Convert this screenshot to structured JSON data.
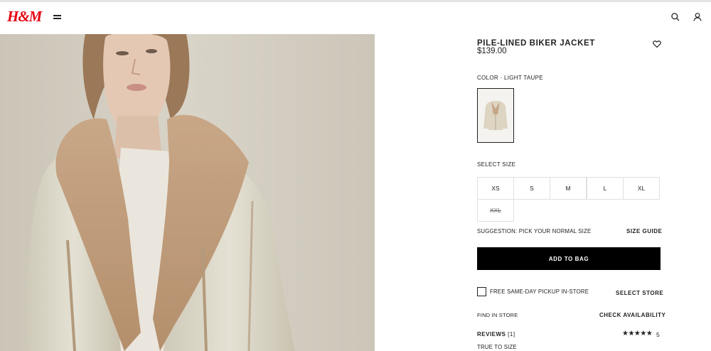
{
  "header": {
    "logo": "H&M"
  },
  "product": {
    "title": "PILE-LINED BIKER JACKET",
    "price": "$139.00",
    "color_label": "COLOR",
    "color_sep": "·",
    "color_value": "LIGHT TAUPE",
    "size_label": "SELECT SIZE",
    "sizes": [
      "XS",
      "S",
      "M",
      "L",
      "XL",
      "XXL"
    ],
    "sold_out_size": "XXL",
    "suggestion": "SUGGESTION: PICK YOUR NORMAL SIZE",
    "size_guide": "SIZE GUIDE",
    "add_to_bag": "ADD TO BAG",
    "pickup_label": "FREE SAME-DAY PICKUP IN-STORE",
    "select_store": "SELECT STORE",
    "find_in_store": "FIND IN STORE",
    "check_availability": "CHECK AVAILABILITY",
    "reviews_label": "REVIEWS",
    "reviews_count": "[1]",
    "stars": "★★★★★",
    "rating": "5",
    "true_to_size": "TRUE TO SIZE"
  },
  "colors": {
    "brand": "#e50010",
    "button": "#000000"
  },
  "icons": [
    "menu-icon",
    "search-icon",
    "account-icon",
    "heart-icon"
  ]
}
